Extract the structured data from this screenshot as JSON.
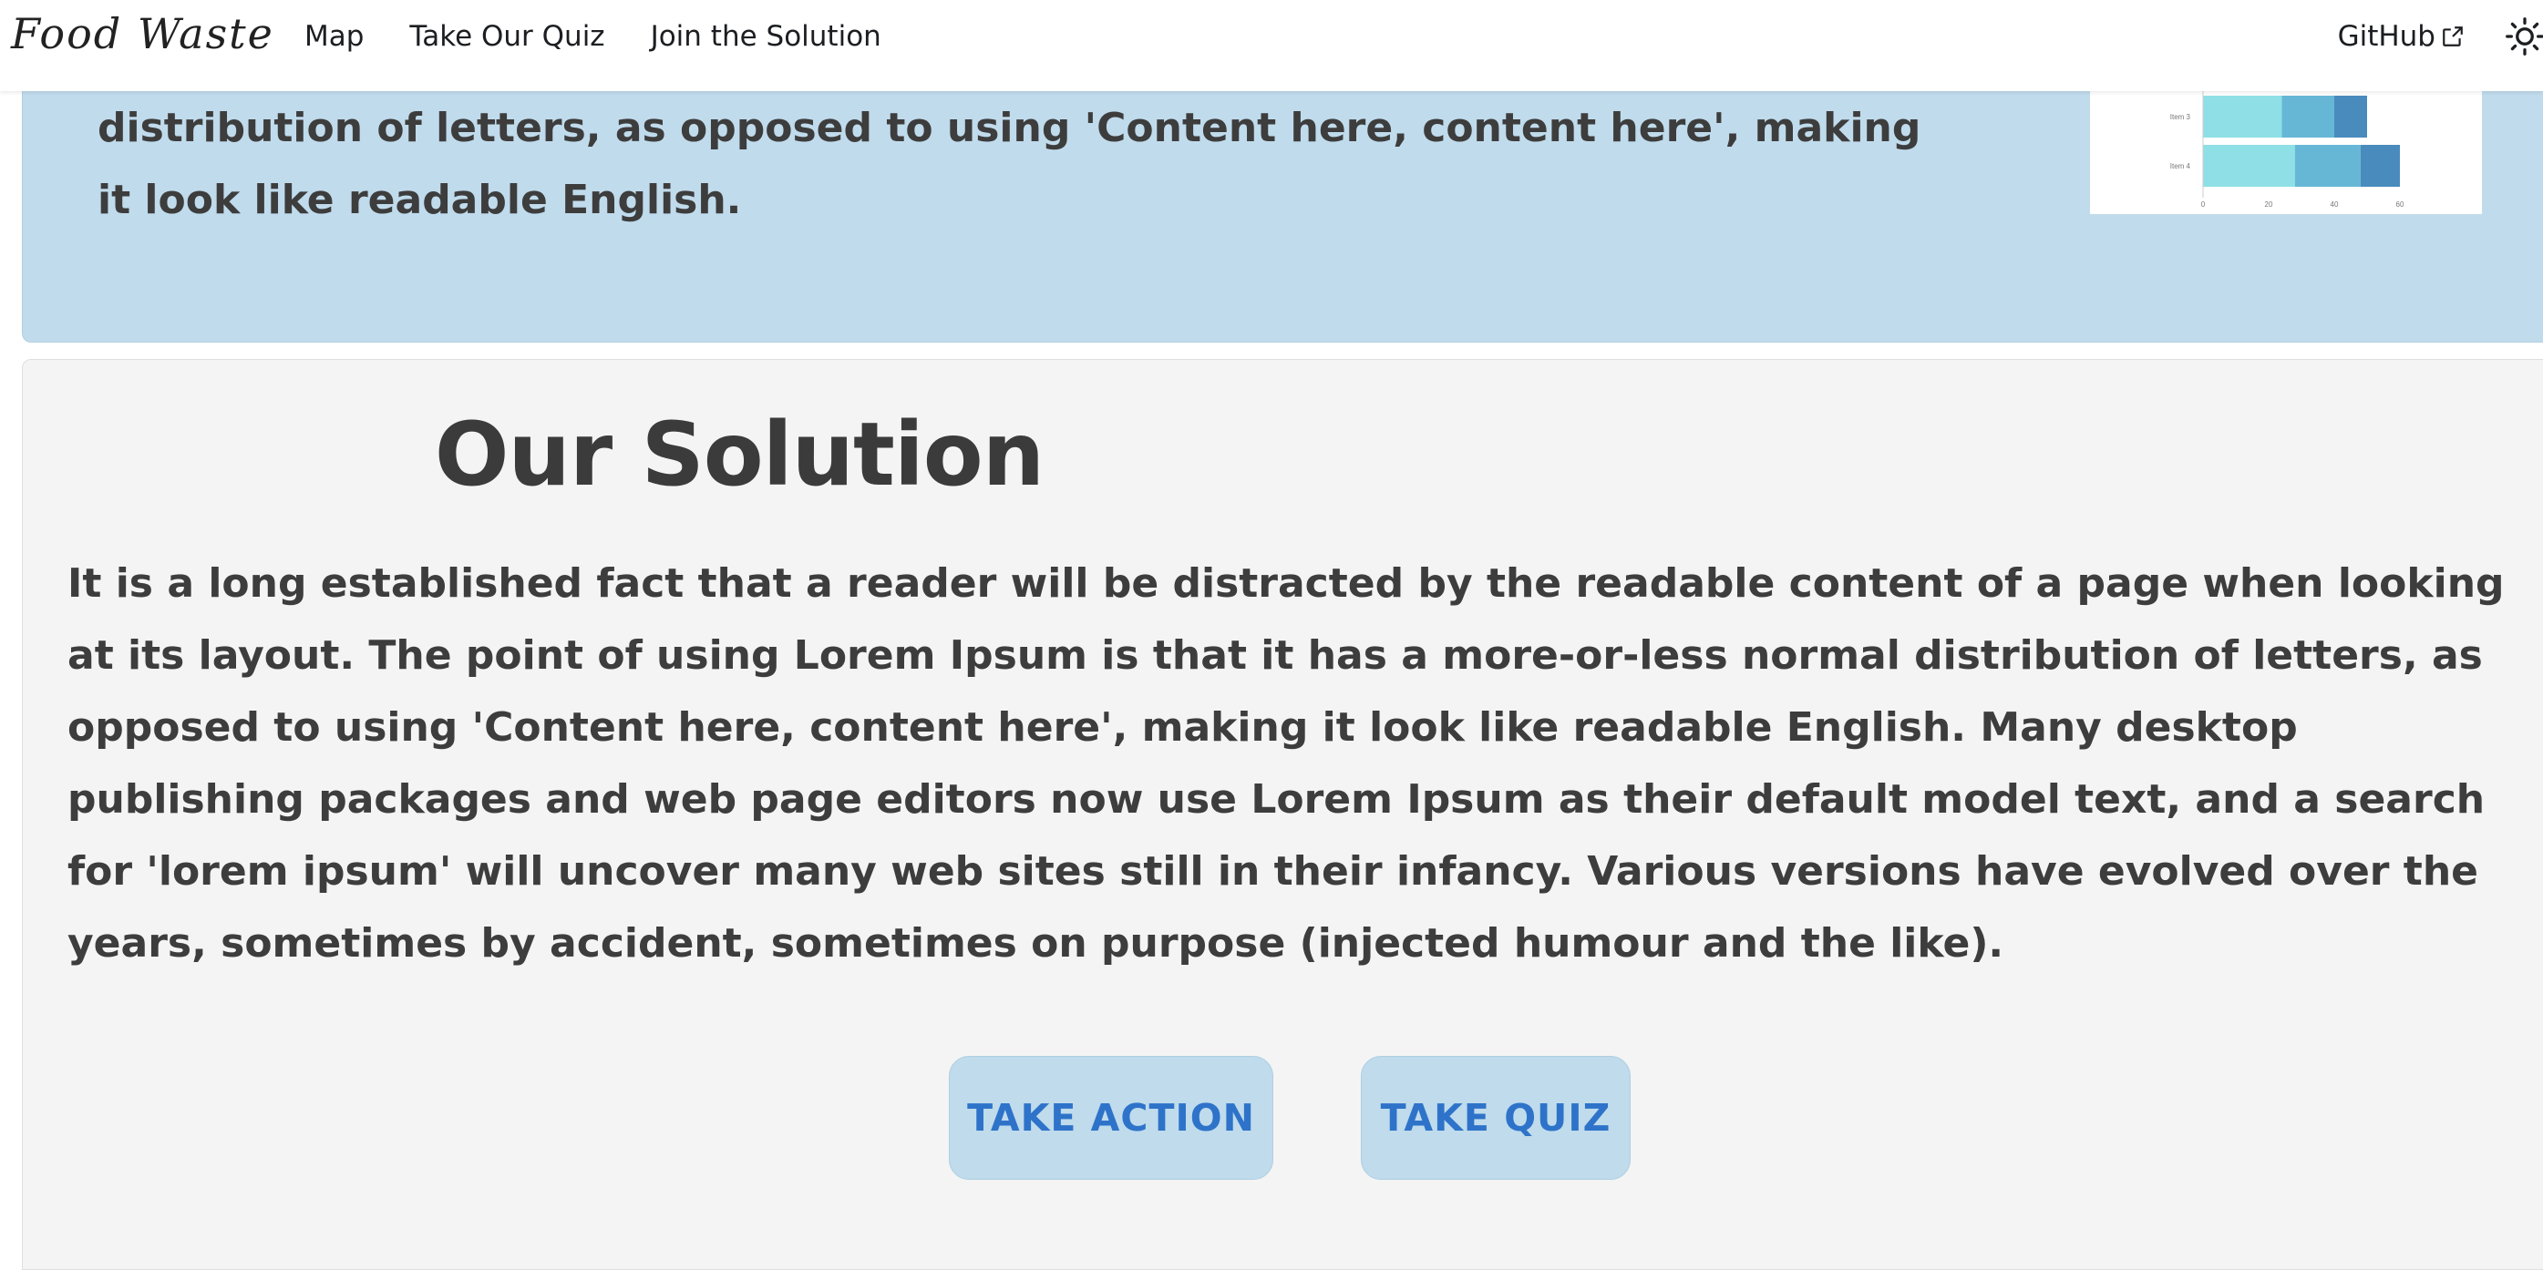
{
  "navbar": {
    "brand": "Food Waste",
    "links": [
      "Map",
      "Take Our Quiz",
      "Join the Solution"
    ],
    "github": "GitHub",
    "icons": {
      "external": "external-link-icon",
      "theme": "sun-icon"
    }
  },
  "hero": {
    "text_tail": "distribution of letters, as opposed to using 'Content here, content here', making it look like readable English."
  },
  "chart_data": {
    "type": "bar",
    "stacked": true,
    "orientation": "horizontal",
    "categories": [
      "Item 3",
      "Item 4"
    ],
    "series": [
      {
        "values": [
          24,
          28
        ],
        "color": "#8ee0e6"
      },
      {
        "values": [
          16,
          20
        ],
        "color": "#66b7d6"
      },
      {
        "values": [
          10,
          12
        ],
        "color": "#4a8bbd"
      }
    ],
    "x_ticks": [
      "0",
      "20",
      "40",
      "60"
    ],
    "xlim": [
      0,
      60
    ]
  },
  "solution": {
    "title": "Our Solution",
    "body": "It is a long established fact that a reader will be distracted by the readable content of a page when looking at its layout. The point of using Lorem Ipsum is that it has a more-or-less normal distribution of letters, as opposed to using 'Content here, content here', making it look like readable English. Many desktop publishing packages and web page editors now use Lorem Ipsum as their default model text, and a search for 'lorem ipsum' will uncover many web sites still in their infancy. Various versions have evolved over the years, sometimes by accident, sometimes on purpose (injected humour and the like).",
    "buttons": {
      "action": "TAKE ACTION",
      "quiz": "TAKE QUIZ"
    }
  },
  "colors": {
    "hero_bg": "#c0dbec",
    "section_bg": "#f4f4f4",
    "button_bg": "#bfdbec",
    "button_text": "#2e73c9"
  }
}
